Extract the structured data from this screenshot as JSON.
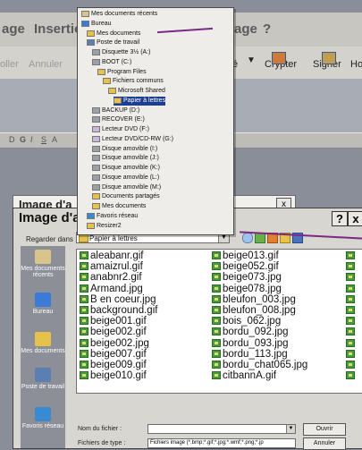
{
  "app_menu": {
    "items": [
      "age",
      "Insertio",
      "age",
      "?"
    ]
  },
  "toolbar": {
    "buttons": [
      "oller",
      "Annuler",
      "é",
      "Crypter",
      "Signer",
      "Ho"
    ]
  },
  "format_bar": {
    "items": [
      "D",
      "G",
      "I",
      "S",
      "A"
    ]
  },
  "back_dialog": {
    "title": "Image d'a",
    "close": "x"
  },
  "dialog": {
    "title": "Image d'a",
    "help_button": "?",
    "close_button": "x",
    "look_in_label": "Regarder dans :",
    "look_in_value": "Papier à lettres",
    "filename_label": "Nom du fichier :",
    "filetype_label": "Fichiers de type :",
    "filetype_value": "Fichiers image (*.bmp;*.gif;*.jpg;*.wmf;*.png;*.jp",
    "open_button": "Ouvrir",
    "cancel_button": "Annuler"
  },
  "places": [
    {
      "label": "Mes documents récents",
      "icon": "recent-docs-icon",
      "color": "#d9c58a"
    },
    {
      "label": "Bureau",
      "icon": "desktop-icon",
      "color": "#3a7bd5"
    },
    {
      "label": "Mes documents",
      "icon": "my-documents-icon",
      "color": "#e6c24a"
    },
    {
      "label": "Poste de travail",
      "icon": "computer-icon",
      "color": "#5a7fb0"
    },
    {
      "label": "Favoris réseau",
      "icon": "network-icon",
      "color": "#3a8ad0"
    }
  ],
  "files": {
    "col1": [
      "aleabanr.gif",
      "amaizrul.gif",
      "anabnr2.gif",
      "Armand.jpg",
      "B en coeur.jpg",
      "background.gif",
      "beige001.gif",
      "beige002.gif",
      "beige002.jpg",
      "beige007.gif",
      "beige009.gif",
      "beige010.gif"
    ],
    "col2": [
      "beige013.gif",
      "beige052.gif",
      "beige073.jpg",
      "beige078.jpg",
      "bleufon_003.jpg",
      "bleufon_008.jpg",
      "bois_062.jpg",
      "bordu_092.jpg",
      "bordu_093.jpg",
      "bordu_113.jpg",
      "bordu_chat065.jpg",
      "citbannA.gif"
    ]
  },
  "tree": [
    {
      "label": "Mes documents récents",
      "level": 0,
      "icon": "recent-docs-icon",
      "color": "#d9c58a"
    },
    {
      "label": "Bureau",
      "level": 0,
      "icon": "desktop-icon",
      "color": "#3a7bd5"
    },
    {
      "label": "Mes documents",
      "level": 1,
      "icon": "folder-icon",
      "color": "#e6c24a"
    },
    {
      "label": "Poste de travail",
      "level": 1,
      "icon": "computer-icon",
      "color": "#5a7fb0"
    },
    {
      "label": "Disquette 3½ (A:)",
      "level": 2,
      "icon": "floppy-icon",
      "color": "#9aa0a8"
    },
    {
      "label": "BOOT (C:)",
      "level": 2,
      "icon": "drive-icon",
      "color": "#9aa0a8"
    },
    {
      "label": "Program Files",
      "level": 3,
      "icon": "folder-icon",
      "color": "#e6c24a"
    },
    {
      "label": "Fichiers communs",
      "level": 4,
      "icon": "folder-icon",
      "color": "#e6c24a"
    },
    {
      "label": "Microsoft Shared",
      "level": 5,
      "icon": "folder-icon",
      "color": "#e6c24a"
    },
    {
      "label": "Papier à lettres",
      "level": 6,
      "icon": "folder-open-icon",
      "color": "#e6c24a",
      "selected": true
    },
    {
      "label": "BACKUP (D:)",
      "level": 2,
      "icon": "drive-icon",
      "color": "#9aa0a8"
    },
    {
      "label": "RECOVER (E:)",
      "level": 2,
      "icon": "drive-icon",
      "color": "#9aa0a8"
    },
    {
      "label": "Lecteur DVD (F:)",
      "level": 2,
      "icon": "dvd-icon",
      "color": "#c8b7d8"
    },
    {
      "label": "Lecteur DVD/CD-RW (G:)",
      "level": 2,
      "icon": "dvd-icon",
      "color": "#c8b7d8"
    },
    {
      "label": "Disque amovible (I:)",
      "level": 2,
      "icon": "removable-disk-icon",
      "color": "#9aa0a8"
    },
    {
      "label": "Disque amovible (J:)",
      "level": 2,
      "icon": "removable-disk-icon",
      "color": "#9aa0a8"
    },
    {
      "label": "Disque amovible (K:)",
      "level": 2,
      "icon": "removable-disk-icon",
      "color": "#9aa0a8"
    },
    {
      "label": "Disque amovible (L:)",
      "level": 2,
      "icon": "removable-disk-icon",
      "color": "#9aa0a8"
    },
    {
      "label": "Disque amovible (M:)",
      "level": 2,
      "icon": "removable-disk-icon",
      "color": "#9aa0a8"
    },
    {
      "label": "Documents partagés",
      "level": 2,
      "icon": "folder-icon",
      "color": "#e6c24a"
    },
    {
      "label": "Mes documents",
      "level": 2,
      "icon": "folder-icon",
      "color": "#e6c24a"
    },
    {
      "label": "Favoris réseau",
      "level": 1,
      "icon": "network-icon",
      "color": "#3a8ad0"
    },
    {
      "label": "Resizer2",
      "level": 1,
      "icon": "folder-icon",
      "color": "#e6c24a"
    }
  ],
  "annotation_color": "#7a2a86"
}
